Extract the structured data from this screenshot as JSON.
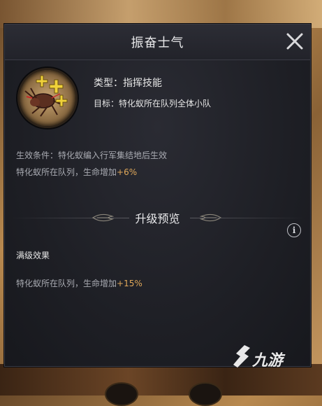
{
  "dialog": {
    "title": "振奋士气",
    "close_icon": "close-x-icon"
  },
  "skill": {
    "icon": "ant-skill-plus-icon",
    "type_text": "类型：指挥技能",
    "target_text": "目标：特化蚁所在队列全体小队",
    "condition_text": "生效条件：特化蚁编入行军集结地后生效",
    "effect_prefix": "特化蚁所在队列，生命增加",
    "effect_value": "+6%"
  },
  "upgrade_preview": {
    "title": "升级预览",
    "info_icon": "info-icon",
    "info_glyph": "i",
    "max_label": "满级效果",
    "max_effect_prefix": "特化蚁所在队列，生命增加",
    "max_effect_value": "+15%"
  },
  "watermark": {
    "text": "九游",
    "logo": "jiuyou-logo-icon"
  },
  "colors": {
    "highlight": "#e0a85a",
    "panel_bg": "#1e1f25",
    "text_main": "#e6e6e6",
    "text_dim": "#a9abb2"
  }
}
